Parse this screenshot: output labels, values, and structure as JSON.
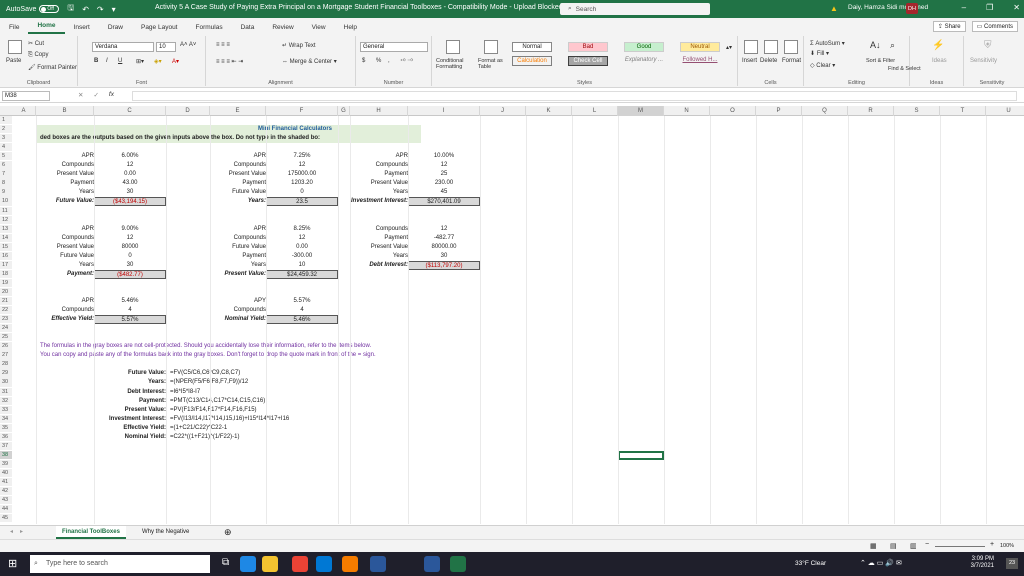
{
  "titlebar": {
    "autosave_label": "AutoSave",
    "autosave_state": "Off",
    "document_title": "Activity 5 A Case Study of Paying Extra Principal on a Mortgage Student Financial Toolboxes  -  Compatibility Mode  -  Upload Blocked",
    "search_placeholder": "Search",
    "warning": "Daiy, Hamza Sidi mohamed",
    "avatar_initials": "DH",
    "minimize": "–",
    "restore": "❐",
    "close": "✕"
  },
  "menu": {
    "tabs": [
      "File",
      "Home",
      "Insert",
      "Draw",
      "Page Layout",
      "Formulas",
      "Data",
      "Review",
      "View",
      "Help"
    ],
    "active": "Home",
    "share": "Share",
    "comments": "Comments"
  },
  "ribbon": {
    "clipboard": {
      "paste": "Paste",
      "cut": "Cut",
      "copy": "Copy",
      "format_painter": "Format Painter",
      "label": "Clipboard"
    },
    "font": {
      "name": "Verdana",
      "size": "10",
      "label": "Font",
      "bold": "B",
      "italic": "I",
      "underline": "U"
    },
    "alignment": {
      "wrap": "Wrap Text",
      "merge": "Merge & Center",
      "label": "Alignment"
    },
    "number": {
      "format": "General",
      "currency": "$",
      "percent": "%",
      "comma": ",",
      "label": "Number"
    },
    "styles": {
      "conditional": "Conditional Formatting",
      "format_table": "Format as Table",
      "normal": "Normal",
      "bad": "Bad",
      "good": "Good",
      "neutral": "Neutral",
      "calculation": "Calculation",
      "check_cell": "Check Cell",
      "explanatory": "Explanatory ...",
      "followed": "Followed H...",
      "label": "Styles"
    },
    "cells": {
      "insert": "Insert",
      "delete": "Delete",
      "format": "Format",
      "label": "Cells"
    },
    "editing": {
      "autosum": "AutoSum",
      "fill": "Fill",
      "clear": "Clear",
      "sort": "Sort & Filter",
      "find": "Find & Select",
      "label": "Editing"
    },
    "ideas": {
      "label": "Ideas",
      "button": "Ideas"
    },
    "sensitivity": {
      "label": "Sensitivity",
      "button": "Sensitivity"
    }
  },
  "formula_bar": {
    "name_box": "M38",
    "fx": "fx",
    "cancel": "✕",
    "enter": "✓",
    "content": ""
  },
  "columns": [
    "A",
    "B",
    "C",
    "D",
    "E",
    "F",
    "G",
    "H",
    "I",
    "J",
    "K",
    "L",
    "M",
    "N",
    "O",
    "P",
    "Q",
    "R",
    "S",
    "T",
    "U",
    "V"
  ],
  "rows": [
    "1",
    "2",
    "3",
    "4",
    "5",
    "6",
    "7",
    "8",
    "9",
    "10",
    "11",
    "12",
    "13",
    "14",
    "15",
    "16",
    "17",
    "18",
    "19",
    "20",
    "21",
    "22",
    "23",
    "24",
    "25",
    "26",
    "27",
    "28",
    "29",
    "30",
    "31",
    "32",
    "33",
    "34",
    "35",
    "36",
    "37",
    "38",
    "39",
    "40",
    "41",
    "42",
    "43",
    "44",
    "45"
  ],
  "sheet": {
    "title": "Mini Financial Calculators",
    "subtitle": "ded boxes are the outputs based on the given inputs above the box. Do not type in the shaded bo:",
    "block1": [
      {
        "label": "APR",
        "value": "6.00%"
      },
      {
        "label": "Compounds",
        "value": "12"
      },
      {
        "label": "Present Value",
        "value": "0.00"
      },
      {
        "label": "Payment",
        "value": "43.00"
      },
      {
        "label": "Years",
        "value": "30"
      }
    ],
    "block1_out": {
      "label": "Future Value:",
      "value": "($43,194.15)"
    },
    "block2": [
      {
        "label": "APR",
        "value": "7.25%"
      },
      {
        "label": "Compounds",
        "value": "12"
      },
      {
        "label": "Present Value",
        "value": "175000.00"
      },
      {
        "label": "Payment",
        "value": "1203.20"
      },
      {
        "label": "Future Value",
        "value": "0"
      }
    ],
    "block2_out": {
      "label": "Years:",
      "value": "23.5"
    },
    "block3": [
      {
        "label": "APR",
        "value": "10.00%"
      },
      {
        "label": "Compounds",
        "value": "12"
      },
      {
        "label": "Payment",
        "value": "25"
      },
      {
        "label": "Present Value",
        "value": "230.00"
      },
      {
        "label": "Years",
        "value": "45"
      }
    ],
    "block3_out": {
      "label": "Investment Interest:",
      "value": "$270,401.09"
    },
    "block4": [
      {
        "label": "APR",
        "value": "9.00%"
      },
      {
        "label": "Compounds",
        "value": "12"
      },
      {
        "label": "Present Value",
        "value": "80000"
      },
      {
        "label": "Future Value",
        "value": "0"
      },
      {
        "label": "Years",
        "value": "30"
      }
    ],
    "block4_out": {
      "label": "Payment:",
      "value": "($482.77)"
    },
    "block5": [
      {
        "label": "APR",
        "value": "8.25%"
      },
      {
        "label": "Compounds",
        "value": "12"
      },
      {
        "label": "Future Value",
        "value": "0.00"
      },
      {
        "label": "Payment",
        "value": "-300.00"
      },
      {
        "label": "Years",
        "value": "10"
      }
    ],
    "block5_out": {
      "label": "Present Value:",
      "value": "$24,459.32"
    },
    "block6": [
      {
        "label": "Compounds",
        "value": "12"
      },
      {
        "label": "Payment",
        "value": "-482.77"
      },
      {
        "label": "Present Value",
        "value": "80000.00"
      },
      {
        "label": "Years",
        "value": "30"
      }
    ],
    "block6_out": {
      "label": "Debt Interest:",
      "value": "($113,797.20)"
    },
    "block7": [
      {
        "label": "APR",
        "value": "5.46%"
      },
      {
        "label": "Compounds",
        "value": "4"
      }
    ],
    "block7_out": {
      "label": "Effective Yield:",
      "value": "5.57%"
    },
    "block8": [
      {
        "label": "APY",
        "value": "5.57%"
      },
      {
        "label": "Compounds",
        "value": "4"
      }
    ],
    "block8_out": {
      "label": "Nominal Yield:",
      "value": "5.46%"
    },
    "note1": "The formulas in the gray boxes are not cell-protected.  Should you accidentally lose their information, refer to the items below.",
    "note2": "You can copy and paste any of the formulas back into the gray boxes. Don't forget to drop the quote mark in front of the = sign.",
    "formulas": [
      {
        "label": "Future Value:",
        "formula": "=FV(C5/C6,C6*C9,C8,C7)"
      },
      {
        "label": "Years:",
        "formula": "=(NPER(F5/F6,F8,F7,F9))/12"
      },
      {
        "label": "Debt Interest:",
        "formula": "=I6*I5*I8-I7"
      },
      {
        "label": "Payment:",
        "formula": "=PMT(C13/C14,C17*C14,C15,C16)"
      },
      {
        "label": "Present Value:",
        "formula": "=PV(F13/F14,F17*F14,F16,F15)"
      },
      {
        "label": "Investment Interest:",
        "formula": "=FV(I13/I14,I17*I14,I15,I16)+I15*I14*I17+I16"
      },
      {
        "label": "Effective Yield:",
        "formula": "=(1+C21/C22)^C22-1"
      },
      {
        "label": "Nominal Yield:",
        "formula": "=C22*((1+F21)^(1/F22)-1)"
      }
    ]
  },
  "sheet_tabs": [
    "Financial ToolBoxes",
    "Why the Negative"
  ],
  "active_sheet": "Financial ToolBoxes",
  "status": {
    "zoom": "100%"
  },
  "taskbar": {
    "search": "Type here to search",
    "weather": "33°F  Clear",
    "time": "3:09 PM",
    "date": "3/7/2021",
    "notifications": "23"
  }
}
